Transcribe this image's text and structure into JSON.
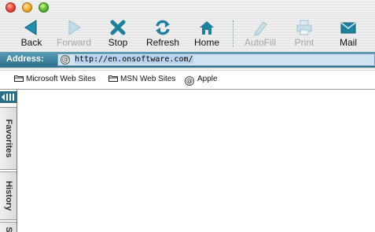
{
  "toolbar": {
    "buttons": [
      {
        "label": "Back",
        "icon": "back-arrow-icon",
        "enabled": true
      },
      {
        "label": "Forward",
        "icon": "forward-arrow-icon",
        "enabled": false
      },
      {
        "label": "Stop",
        "icon": "stop-x-icon",
        "enabled": true
      },
      {
        "label": "Refresh",
        "icon": "refresh-icon",
        "enabled": true
      },
      {
        "label": "Home",
        "icon": "home-icon",
        "enabled": true
      },
      {
        "label": "AutoFill",
        "icon": "autofill-pen-icon",
        "enabled": false
      },
      {
        "label": "Print",
        "icon": "printer-icon",
        "enabled": false
      },
      {
        "label": "Mail",
        "icon": "mail-icon",
        "enabled": true
      }
    ]
  },
  "address": {
    "label": "Address:",
    "url": "http://en.onsoftware.com/"
  },
  "favorites": [
    {
      "label": "Microsoft Web Sites",
      "icon": "folder-icon"
    },
    {
      "label": "MSN Web Sites",
      "icon": "folder-icon"
    },
    {
      "label": "Apple",
      "icon": "at-link-icon"
    }
  ],
  "sidebar": {
    "tabs": [
      "Favorites",
      "History",
      "S"
    ]
  },
  "colors": {
    "accent": "#2a6e8a",
    "icon_blue": "#1f7f9e",
    "address_field": "#cfe3f2",
    "disabled": "#a5a5a5"
  }
}
